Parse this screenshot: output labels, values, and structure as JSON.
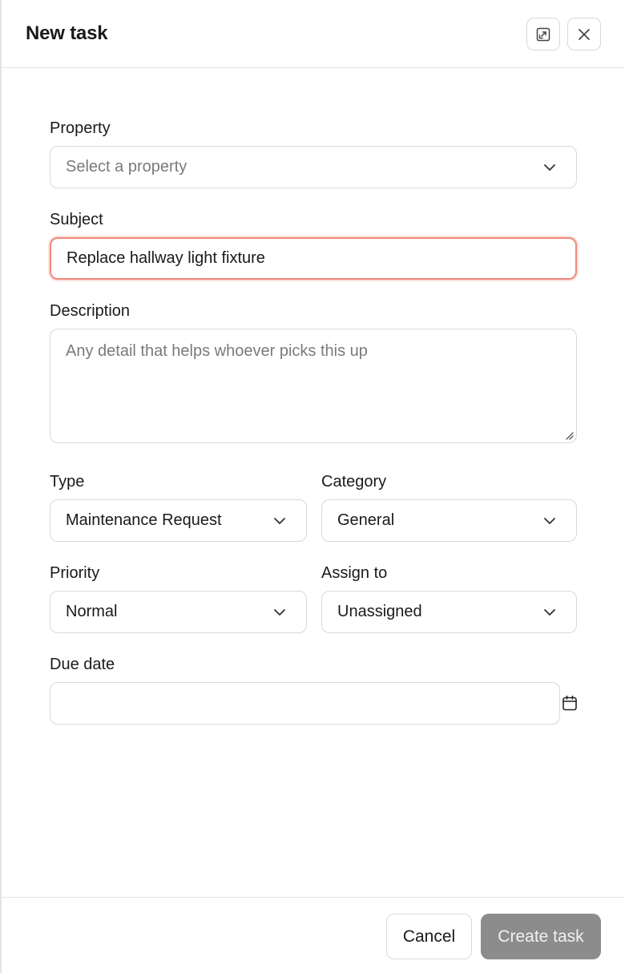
{
  "header": {
    "title": "New task"
  },
  "form": {
    "property": {
      "label": "Property",
      "placeholder": "Select a property"
    },
    "subject": {
      "label": "Subject",
      "value": "Replace hallway light fixture"
    },
    "description": {
      "label": "Description",
      "placeholder": "Any detail that helps whoever picks this up"
    },
    "type": {
      "label": "Type",
      "value": "Maintenance Request"
    },
    "category": {
      "label": "Category",
      "value": "General"
    },
    "priority": {
      "label": "Priority",
      "value": "Normal"
    },
    "assign_to": {
      "label": "Assign to",
      "value": "Unassigned"
    },
    "due_date": {
      "label": "Due date",
      "value": ""
    }
  },
  "footer": {
    "cancel_label": "Cancel",
    "create_label": "Create task"
  },
  "colors": {
    "focus_ring": "#ef8a7d",
    "primary_disabled": "#8c8c8c",
    "border": "#d9d9d9"
  },
  "icons": {
    "expand": "expand-icon",
    "close": "close-icon",
    "chevron": "chevron-down-icon",
    "calendar": "calendar-icon"
  }
}
